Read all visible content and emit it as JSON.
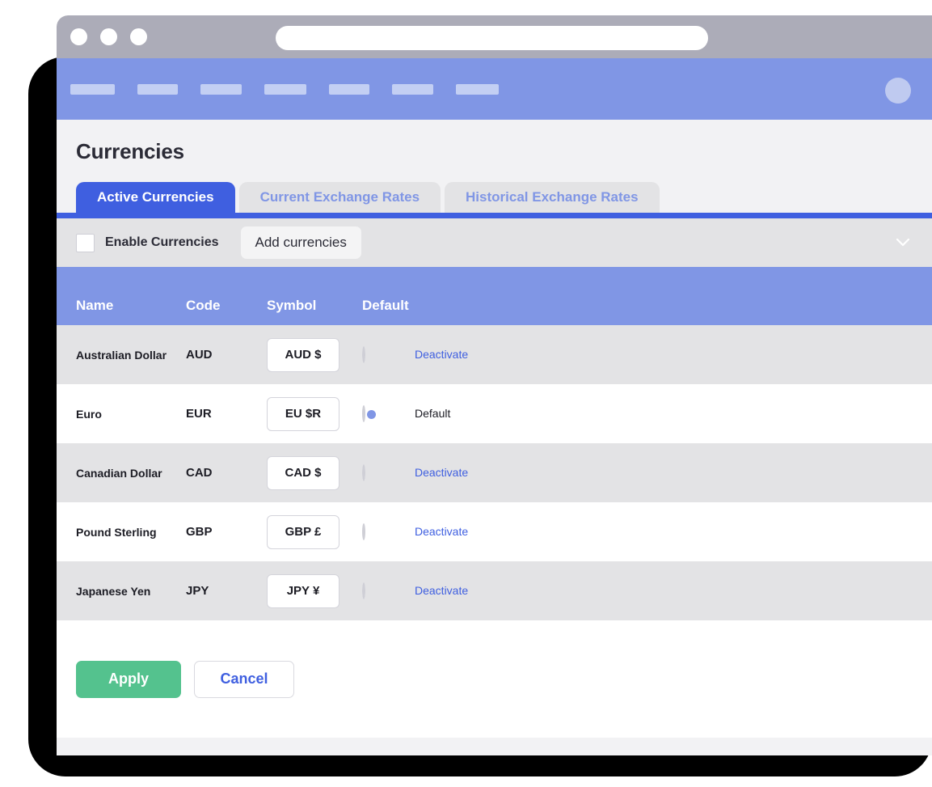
{
  "browser": {
    "url_value": "",
    "url_placeholder": "",
    "dots": [
      "close-dot",
      "minimize-dot",
      "maximize-dot"
    ]
  },
  "navbar": {
    "placeholders": [
      "",
      "",
      "",
      "",
      "",
      "",
      ""
    ],
    "avatar_label": ""
  },
  "page": {
    "title": "Currencies"
  },
  "tabs": [
    {
      "label": "Active Currencies",
      "active": true
    },
    {
      "label": "Current Exchange Rates",
      "active": false
    },
    {
      "label": "Historical Exchange Rates",
      "active": false
    }
  ],
  "toolbar": {
    "enable_label": "Enable Currencies",
    "enable_checked": false,
    "add_label": "Add currencies",
    "expand_icon": "chevron-down-icon"
  },
  "table": {
    "headers": [
      "Name",
      "Code",
      "Symbol",
      "Default",
      ""
    ],
    "rows": [
      {
        "name": "Australian Dollar",
        "code": "AUD",
        "symbol": "AUD $",
        "is_default": false,
        "action": "Deactivate"
      },
      {
        "name": "Euro",
        "code": "EUR",
        "symbol": "EU $R",
        "is_default": true,
        "action": "Default"
      },
      {
        "name": "Canadian Dollar",
        "code": "CAD",
        "symbol": "CAD $",
        "is_default": false,
        "action": "Deactivate"
      },
      {
        "name": "Pound Sterling",
        "code": "GBP",
        "symbol": "GBP £",
        "is_default": false,
        "action": "Deactivate"
      },
      {
        "name": "Japanese Yen",
        "code": "JPY",
        "symbol": "JPY ¥",
        "is_default": false,
        "action": "Deactivate"
      }
    ]
  },
  "footer": {
    "apply_label": "Apply",
    "cancel_label": "Cancel"
  },
  "colors": {
    "brand_blue": "#3f5fe0",
    "light_blue": "#8096e5",
    "accent_green": "#54c28e",
    "link_blue": "#3f5fe0",
    "chrome_gray": "#acacb8",
    "row_alt": "#e3e3e5"
  }
}
